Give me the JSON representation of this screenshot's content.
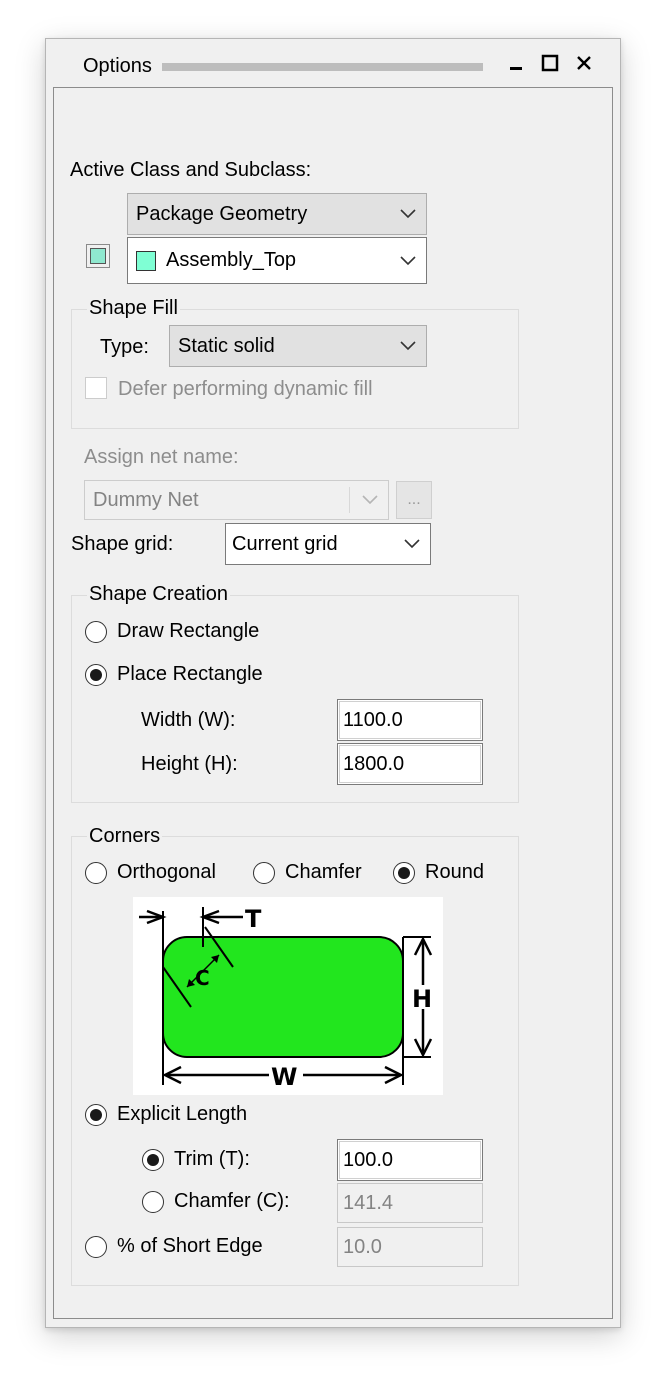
{
  "window": {
    "title": "Options"
  },
  "class_subclass": {
    "label": "Active Class and Subclass:",
    "class_value": "Package Geometry",
    "subclass_value": "Assembly_Top",
    "swatch_color": "#7fffd4"
  },
  "shape_fill": {
    "group_label": "Shape Fill",
    "type_label": "Type:",
    "type_value": "Static solid",
    "defer_label": "Defer performing dynamic fill"
  },
  "net": {
    "label": "Assign net name:",
    "value": "Dummy Net",
    "browse_label": "..."
  },
  "shape_grid": {
    "label": "Shape grid:",
    "value": "Current grid"
  },
  "shape_creation": {
    "group_label": "Shape Creation",
    "draw_label": "Draw Rectangle",
    "place_label": "Place Rectangle",
    "width_label": "Width (W):",
    "width_value": "1100.0",
    "height_label": "Height (H):",
    "height_value": "1800.0"
  },
  "corners": {
    "group_label": "Corners",
    "orthogonal_label": "Orthogonal",
    "chamfer_label": "Chamfer",
    "round_label": "Round",
    "diagram": {
      "t": "T",
      "c": "C",
      "h": "H",
      "w": "W",
      "fill_color": "#22e61e"
    },
    "explicit_label": "Explicit Length",
    "trim_label": "Trim (T):",
    "trim_value": "100.0",
    "chamfer_c_label": "Chamfer (C):",
    "chamfer_c_value": "141.4",
    "percent_label": "% of Short Edge",
    "percent_value": "10.0"
  }
}
